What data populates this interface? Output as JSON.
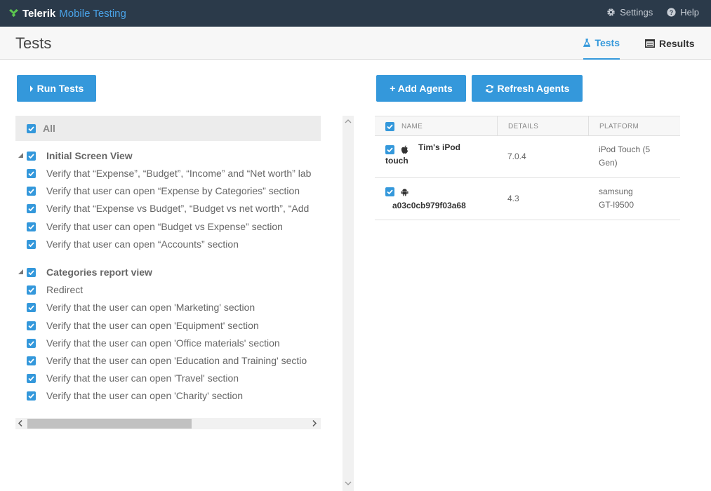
{
  "app": {
    "brand_name": "Telerik",
    "product_name": "Mobile Testing",
    "logo_icon": "telerik-logo-icon"
  },
  "topnav": {
    "settings_label": "Settings",
    "help_label": "Help"
  },
  "header": {
    "title": "Tests",
    "tabs": [
      {
        "label": "Tests",
        "icon": "flask-icon",
        "active": true
      },
      {
        "label": "Results",
        "icon": "list-icon",
        "active": false
      }
    ]
  },
  "toolbar": {
    "run_tests_label": "Run Tests",
    "add_agents_label": "+ Add Agents",
    "refresh_agents_label": "Refresh Agents"
  },
  "tests": {
    "all_label": "All",
    "groups": [
      {
        "label": "Initial Screen View",
        "items": [
          "Verify that “Expense”, “Budget”, “Income” and “Net worth” lab",
          "Verify that user can open “Expense by Categories” section",
          "Verify that “Expense vs Budget”, “Budget vs net worth”, “Add",
          "Verify that user can open “Budget vs Expense” section",
          "Verify that user can open “Accounts” section"
        ]
      },
      {
        "label": "Categories report view",
        "items": [
          "Redirect",
          "Verify that the user can open 'Marketing' section",
          "Verify that the user can open 'Equipment' section",
          "Verify that the user can open 'Office materials' section",
          "Verify that the user can open 'Education and Training' sectio",
          "Verify that the user can open 'Travel' section",
          "Verify that the user can open 'Charity' section"
        ]
      }
    ]
  },
  "agents": {
    "columns": {
      "name": "NAME",
      "details": "DETAILS",
      "platform": "PLATFORM"
    },
    "rows": [
      {
        "os_icon": "apple-icon",
        "name_line1": "Tim's iPod",
        "name_line2": "touch",
        "details": "7.0.4",
        "platform_line1": "iPod Touch (5",
        "platform_line2": "Gen)"
      },
      {
        "os_icon": "android-icon",
        "name_line1": "",
        "name_line2": "a03c0cb979f03a68",
        "details": "4.3",
        "platform_line1": "samsung",
        "platform_line2": "GT-I9500"
      }
    ]
  },
  "colors": {
    "topbar": "#2b3a4a",
    "accent": "#3498db",
    "product": "#4aa3e8"
  }
}
